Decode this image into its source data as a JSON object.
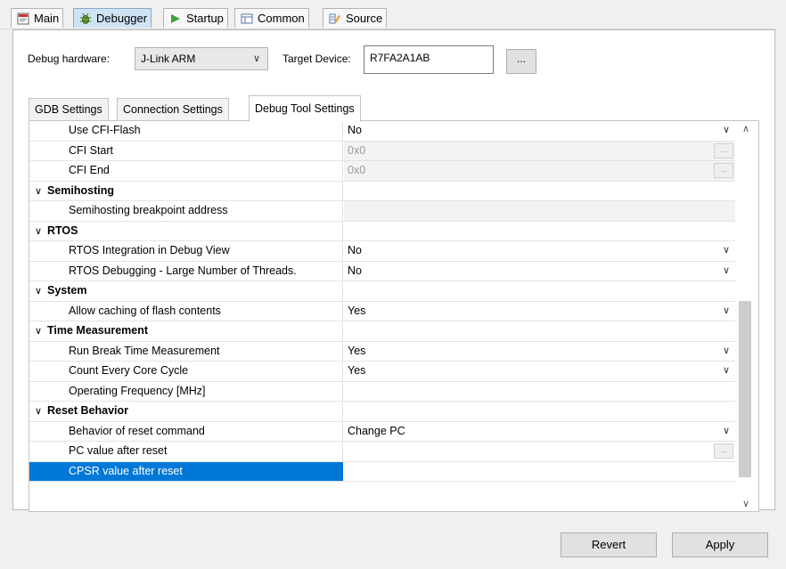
{
  "tabs": [
    {
      "label": "Main",
      "icon": "main-tab-icon"
    },
    {
      "label": "Debugger",
      "icon": "debugger-bug-icon",
      "active": true
    },
    {
      "label": "Startup",
      "icon": "play-icon"
    },
    {
      "label": "Common",
      "icon": "common-icon"
    },
    {
      "label": "Source",
      "icon": "source-icon"
    }
  ],
  "hardware": {
    "label": "Debug hardware:",
    "value": "J-Link ARM",
    "target_label": "Target Device:",
    "target_value": "R7FA2A1AB",
    "browse_label": "..."
  },
  "subtabs": [
    "GDB Settings",
    "Connection Settings",
    "Debug Tool Settings"
  ],
  "table": {
    "rows": [
      {
        "name": "Use CFI-Flash",
        "value": "No"
      },
      {
        "name": "CFI Start",
        "value": "0x0"
      },
      {
        "name": "CFI End",
        "value": "0x0"
      },
      {
        "name": "Semihosting",
        "value": ""
      },
      {
        "name": "Semihosting breakpoint address",
        "value": ""
      },
      {
        "name": "RTOS",
        "value": ""
      },
      {
        "name": "RTOS Integration in Debug View",
        "value": "No"
      },
      {
        "name": "RTOS Debugging - Large Number of Threads.",
        "value": "No"
      },
      {
        "name": "System",
        "value": ""
      },
      {
        "name": "Allow caching of flash contents",
        "value": "Yes"
      },
      {
        "name": "Time Measurement",
        "value": ""
      },
      {
        "name": "Run Break Time Measurement",
        "value": "Yes"
      },
      {
        "name": "Count Every Core Cycle",
        "value": "Yes"
      },
      {
        "name": "Operating Frequency [MHz]",
        "value": ""
      },
      {
        "name": "Reset Behavior",
        "value": ""
      },
      {
        "name": "Behavior of reset command",
        "value": "Change PC"
      },
      {
        "name": "PC value after reset",
        "value": ""
      },
      {
        "name": "CPSR value after reset",
        "value": ""
      }
    ]
  },
  "buttons": {
    "revert": "Revert",
    "apply": "Apply"
  },
  "colors": {
    "selection": "#0078d7",
    "active_tab": "#cfe3f5"
  }
}
